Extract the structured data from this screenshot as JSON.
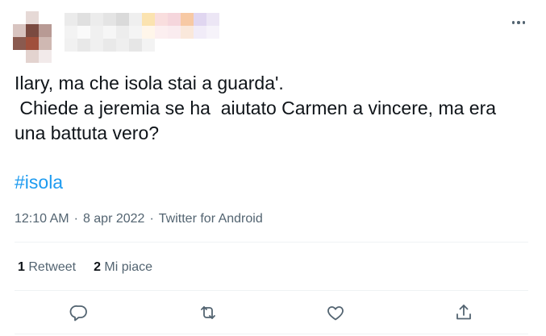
{
  "tweet": {
    "text": "Ilary, ma che isola stai a guarda'.\n Chiede a jeremia se ha  aiutato Carmen a vincere, ma era una battuta vero?",
    "hashtag": "#isola",
    "time": "12:10 AM",
    "date": "8 apr 2022",
    "source": "Twitter for Android",
    "separator": "·"
  },
  "stats": {
    "retweets_count": "1",
    "retweets_label": "Retweet",
    "likes_count": "2",
    "likes_label": "Mi piace"
  },
  "actions": {
    "reply": "reply-icon",
    "retweet": "retweet-icon",
    "like": "heart-icon",
    "share": "share-icon"
  },
  "colors": {
    "accent": "#1d9bf0",
    "secondary_text": "#536471",
    "primary_text": "#0f1419",
    "divider": "#eff3f4"
  }
}
